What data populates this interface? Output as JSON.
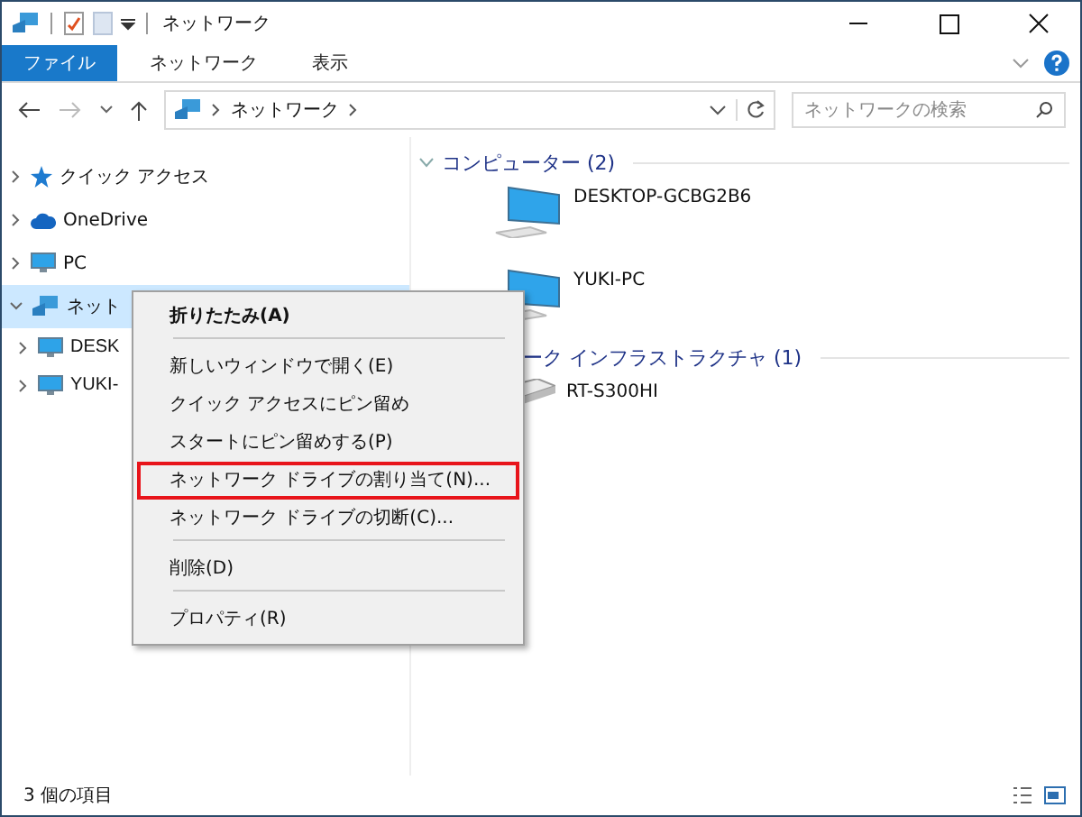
{
  "window": {
    "title": "ネットワーク"
  },
  "ribbon_tabs": [
    {
      "label": "ファイル",
      "selected": true
    },
    {
      "label": "ネットワーク",
      "selected": false
    },
    {
      "label": "表示",
      "selected": false
    }
  ],
  "address": {
    "path": "ネットワーク"
  },
  "search": {
    "placeholder": "ネットワークの検索"
  },
  "sidebar": {
    "items": [
      {
        "label": "クイック アクセス",
        "expanded": false,
        "selected": false
      },
      {
        "label": "OneDrive",
        "expanded": false,
        "selected": false
      },
      {
        "label": "PC",
        "expanded": false,
        "selected": false
      },
      {
        "label": "ネット",
        "expanded": true,
        "selected": true,
        "children": [
          {
            "label": "DESK",
            "expanded": false,
            "selected": false
          },
          {
            "label": "YUKI-",
            "expanded": false,
            "selected": false
          }
        ]
      }
    ]
  },
  "groups": [
    {
      "heading": "コンピューター (2)",
      "chevron": true,
      "items": [
        {
          "name": "DESKTOP-GCBG2B6",
          "kind": "computer"
        },
        {
          "name": "YUKI-PC",
          "kind": "computer"
        }
      ]
    },
    {
      "heading": "ーク インフラストラクチャ (1)",
      "chevron": false,
      "items": [
        {
          "name": "RT-S300HI",
          "kind": "router"
        }
      ]
    }
  ],
  "context_menu": [
    {
      "label": "折りたたみ(A)",
      "kind": "default",
      "separator_after": true,
      "highlighted": false
    },
    {
      "label": "新しいウィンドウで開く(E)",
      "kind": "normal",
      "separator_after": false,
      "highlighted": false
    },
    {
      "label": "クイック アクセスにピン留め",
      "kind": "normal",
      "separator_after": false,
      "highlighted": false
    },
    {
      "label": "スタートにピン留めする(P)",
      "kind": "normal",
      "separator_after": false,
      "highlighted": false
    },
    {
      "label": "ネットワーク ドライブの割り当て(N)...",
      "kind": "normal",
      "separator_after": false,
      "highlighted": true
    },
    {
      "label": "ネットワーク ドライブの切断(C)...",
      "kind": "normal",
      "separator_after": true,
      "highlighted": false
    },
    {
      "label": "削除(D)",
      "kind": "normal",
      "separator_after": true,
      "highlighted": false
    },
    {
      "label": "プロパティ(R)",
      "kind": "normal",
      "separator_after": false,
      "highlighted": false
    }
  ],
  "status_bar": {
    "text": "3 個の項目"
  }
}
